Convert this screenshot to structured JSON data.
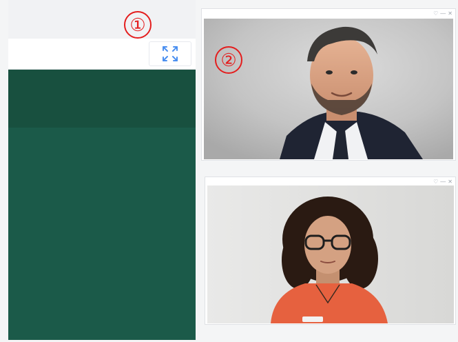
{
  "annotations": {
    "callout_1": "①",
    "callout_2": "②"
  },
  "left_panel": {
    "expand_button_icon": "expand-arrows-icon"
  },
  "tiles": [
    {
      "name": "video-tile-man",
      "controls": [
        "♡",
        "—",
        "✕"
      ]
    },
    {
      "name": "video-tile-woman",
      "controls": [
        "♡",
        "—",
        "✕"
      ]
    }
  ],
  "colors": {
    "panel_green": "#1b5a49",
    "panel_green_dark": "#18503f",
    "accent_blue": "#4a8ff0",
    "annotation_red": "#e41d1d"
  }
}
